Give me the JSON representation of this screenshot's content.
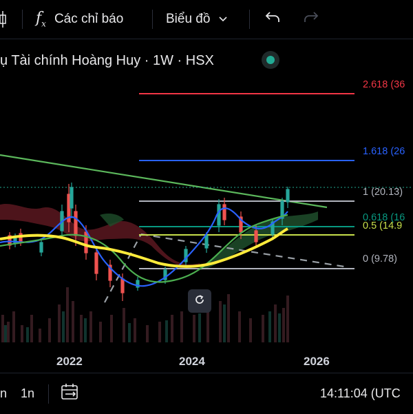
{
  "toolbar": {
    "indicators_label": "Các chỉ báo",
    "chart_type_label": "Biểu đồ"
  },
  "legend": {
    "title": "ụ Tài chính Hoàng Huy · 1W · HSX"
  },
  "fib_levels": [
    {
      "label": "2.618 (36",
      "color": "#f23645"
    },
    {
      "label": "1.618 (26",
      "color": "#2962ff"
    },
    {
      "label": "1 (20.13)",
      "color": "#b2b5be"
    },
    {
      "label": "0.618 (16",
      "color": "#089981"
    },
    {
      "label": "0.5 (14.9",
      "color": "#c8e04b"
    },
    {
      "label": "0 (9.78)",
      "color": "#b2b5be"
    }
  ],
  "x_axis": {
    "labels": [
      "2022",
      "2024",
      "2026"
    ]
  },
  "bottom": {
    "range_1": "n",
    "range_2": "1n",
    "time": "14:11:04 (UTC"
  }
}
